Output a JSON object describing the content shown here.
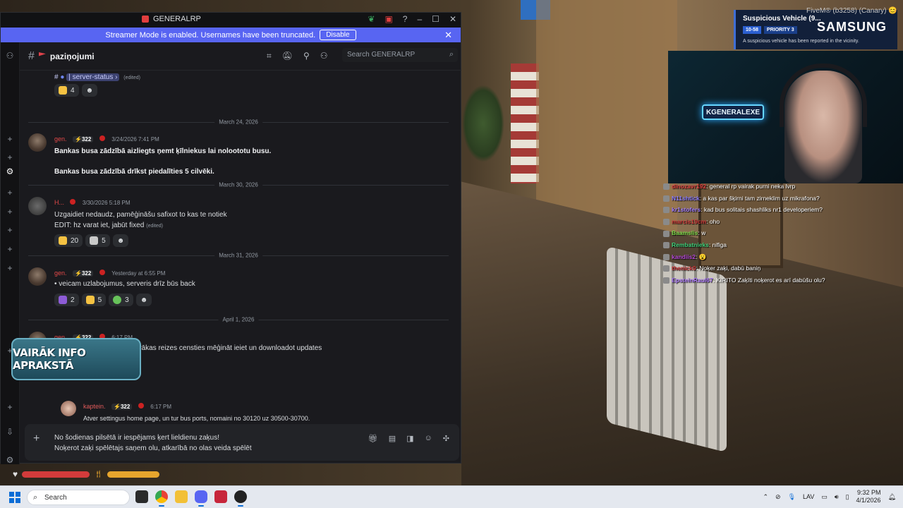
{
  "window": {
    "title": "GENERALRP"
  },
  "banner": {
    "text": "Streamer Mode is enabled. Usernames have been truncated.",
    "disable_label": "Disable"
  },
  "channel": {
    "name": "paziņojumi",
    "search_placeholder": "Search GENERALRP"
  },
  "messages": {
    "top": {
      "channel_link": "server-status",
      "edited": "(edited)",
      "react_count": "4"
    },
    "d1": "March 24, 2026",
    "m1": {
      "author": "gen.",
      "badge": "322",
      "time": "3/24/2026 7:41 PM",
      "line1": "Bankas busa zādzībā aizliegts ņemt ķīlniekus lai noloototu busu.",
      "line2": "Bankas busa zādzībā drīkst piedalīties 5 cilvēki."
    },
    "d2": "March 30, 2026",
    "m2": {
      "author": "H...",
      "time": "3/30/2026 5:18 PM",
      "line1": "Uzgaidiet nedaudz, pamēģināšu safixot to kas te notiek",
      "line2": "EDIT: hz varat iet, jabūt fixed",
      "edited": "(edited)",
      "r1": "20",
      "r2": "5"
    },
    "d3": "March 31, 2026",
    "m3": {
      "author": "gen.",
      "badge": "322",
      "time": "Yesterday at 6:55 PM",
      "bullet": "veicam uzlabojumus, serveris drīz būs back",
      "r1": "2",
      "r2": "5",
      "r3": "3"
    },
    "d4": "April 1, 2026",
    "m4": {
      "author": "gen.",
      "badge": "322",
      "time": "6:17 PM",
      "bullet": "serveris iet, vajag tikai vairākas reizes censties mēģināt ieiet un downloadot updates"
    },
    "m5": {
      "author": "kaptein.",
      "badge": "322",
      "time": "6:17 PM",
      "text": "Atver settingus home page, un tur bus ports, nomaini no 30120 uz 30500-30700."
    }
  },
  "composer": {
    "line1": "No šodienas pilsētā ir iespējams ķert lieldienu zaķus!",
    "line2": "Noķerot zaķi spēlētajs saņem olu, atkarībā no olas veida spēlēt"
  },
  "overlay": {
    "info_text": "VAIRĀK INFO APRAKSTĀ",
    "neon_text": "KGENERALEXE"
  },
  "notification": {
    "fivem": "FiveM® (b3258) (Canary) 😊",
    "title": "Suspicious Vehicle (9...",
    "code1": "10-58",
    "code2": "PRIORITY 3",
    "desc": "A suspicious vehicle has been reported in the vicinity.",
    "brand": "SAMSUNG"
  },
  "chat": [
    {
      "user": "dinozavr192",
      "color": "#e04040",
      "msg": ": general rp vairak purni neka lvrp"
    },
    {
      "user": "N11shtick",
      "color": "#8a7cff",
      "msg": ": a kas par šķirni tam zirneklim uz mikrafona?"
    },
    {
      "user": "kr1stofers",
      "color": "#9f7cff",
      "msg": ": kad bus solitais shashliks nr1 developeriem?"
    },
    {
      "user": "marcis19cm",
      "color": "#d23b3b",
      "msg": ": oho"
    },
    {
      "user": "Baamslis",
      "color": "#7cd94a",
      "msg": ": w"
    },
    {
      "user": "Rembatnieks",
      "color": "#3fd07a",
      "msg": ": nifiga"
    },
    {
      "user": "kandiis2",
      "color": "#b44ad6",
      "msg": ": 😮"
    },
    {
      "user": "thenick0",
      "color": "#d23b3b",
      "msg": ": Noķer zaķi, dabū baniņ"
    },
    {
      "user": "EpsteinRaul67",
      "color": "#b07cff",
      "msg": ": KIRITO Zaķīti noķerot es arī dabūšu olu?"
    }
  ],
  "taskbar": {
    "search": "Search",
    "lang": "LAV",
    "time": "9:32 PM",
    "date": "4/1/2026"
  },
  "colors": {
    "blurple": "#5865f2",
    "author_red": "#e04848",
    "hp": "#d33b3b",
    "food": "#e7a52d"
  }
}
